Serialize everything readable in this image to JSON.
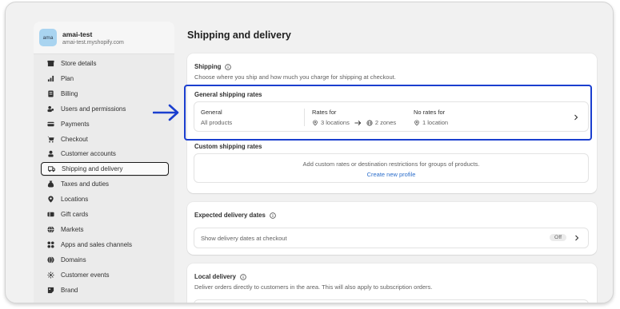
{
  "store": {
    "avatar": "ama",
    "name": "amai-test",
    "domain": "amai-test.myshopify.com"
  },
  "sidebar": {
    "items": [
      {
        "label": "Store details",
        "icon": "store-icon"
      },
      {
        "label": "Plan",
        "icon": "plan-icon"
      },
      {
        "label": "Billing",
        "icon": "billing-icon"
      },
      {
        "label": "Users and permissions",
        "icon": "users-icon"
      },
      {
        "label": "Payments",
        "icon": "payments-icon"
      },
      {
        "label": "Checkout",
        "icon": "cart-icon"
      },
      {
        "label": "Customer accounts",
        "icon": "person-icon"
      },
      {
        "label": "Shipping and delivery",
        "icon": "truck-icon",
        "active": true
      },
      {
        "label": "Taxes and duties",
        "icon": "tax-icon"
      },
      {
        "label": "Locations",
        "icon": "location-icon"
      },
      {
        "label": "Gift cards",
        "icon": "gift-card-icon"
      },
      {
        "label": "Markets",
        "icon": "globe-icon"
      },
      {
        "label": "Apps and sales channels",
        "icon": "apps-icon"
      },
      {
        "label": "Domains",
        "icon": "domains-icon"
      },
      {
        "label": "Customer events",
        "icon": "events-icon"
      },
      {
        "label": "Brand",
        "icon": "brand-icon"
      }
    ]
  },
  "main": {
    "title": "Shipping and delivery",
    "shipping": {
      "heading": "Shipping",
      "description": "Choose where you ship and how much you charge for shipping at checkout.",
      "general_rates_title": "General shipping rates",
      "general_label": "General",
      "general_value": "All products",
      "rates_for_label": "Rates for",
      "locations": "3 locations",
      "zones": "2 zones",
      "no_rates_label": "No rates for",
      "no_rates_value": "1 location",
      "custom_rates_title": "Custom shipping rates",
      "custom_description": "Add custom rates or destination restrictions for groups of products.",
      "create_link": "Create new profile"
    },
    "expected": {
      "heading": "Expected delivery dates",
      "row_label": "Show delivery dates at checkout",
      "status": "Off"
    },
    "local": {
      "heading": "Local delivery",
      "description": "Deliver orders directly to customers in the area. This will also apply to subscription orders."
    }
  },
  "colors": {
    "highlight": "#1b3fcf",
    "link": "#2c6ecb"
  }
}
